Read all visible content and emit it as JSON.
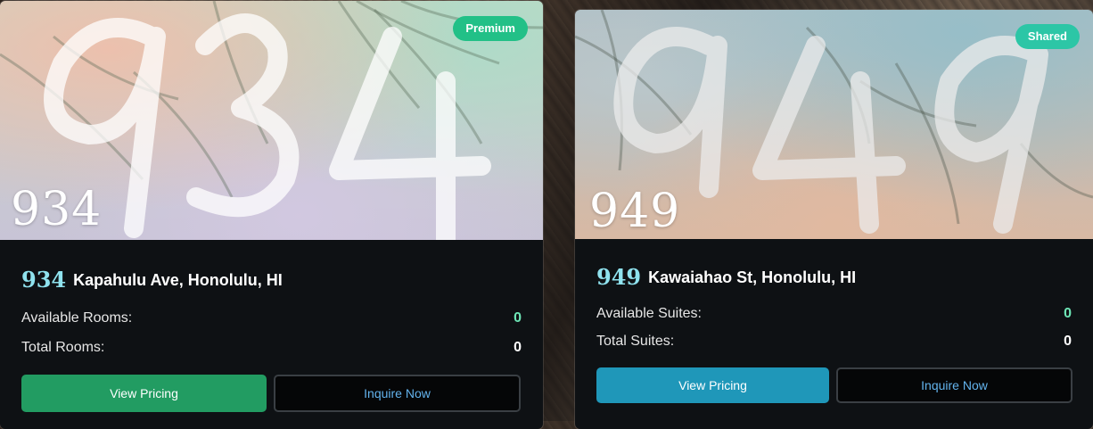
{
  "cards": [
    {
      "badge": "Premium",
      "hero_number": "934",
      "title_number": "934",
      "title_street": "Kapahulu Ave, Honolulu, HI",
      "rows": [
        {
          "label": "Available Rooms:",
          "value": "0"
        },
        {
          "label": "Total Rooms:",
          "value": "0"
        }
      ],
      "primary_button": "View Pricing",
      "secondary_button": "Inquire Now",
      "colors": {
        "badge": "#22c087",
        "primary_button": "#229c62"
      }
    },
    {
      "badge": "Shared",
      "hero_number": "949",
      "title_number": "949",
      "title_street": "Kawaiahao St, Honolulu, HI",
      "rows": [
        {
          "label": "Available Suites:",
          "value": "0"
        },
        {
          "label": "Total Suites:",
          "value": "0"
        }
      ],
      "primary_button": "View Pricing",
      "secondary_button": "Inquire Now",
      "colors": {
        "badge": "#2cc6a6",
        "primary_button": "#1f97b9"
      }
    }
  ]
}
